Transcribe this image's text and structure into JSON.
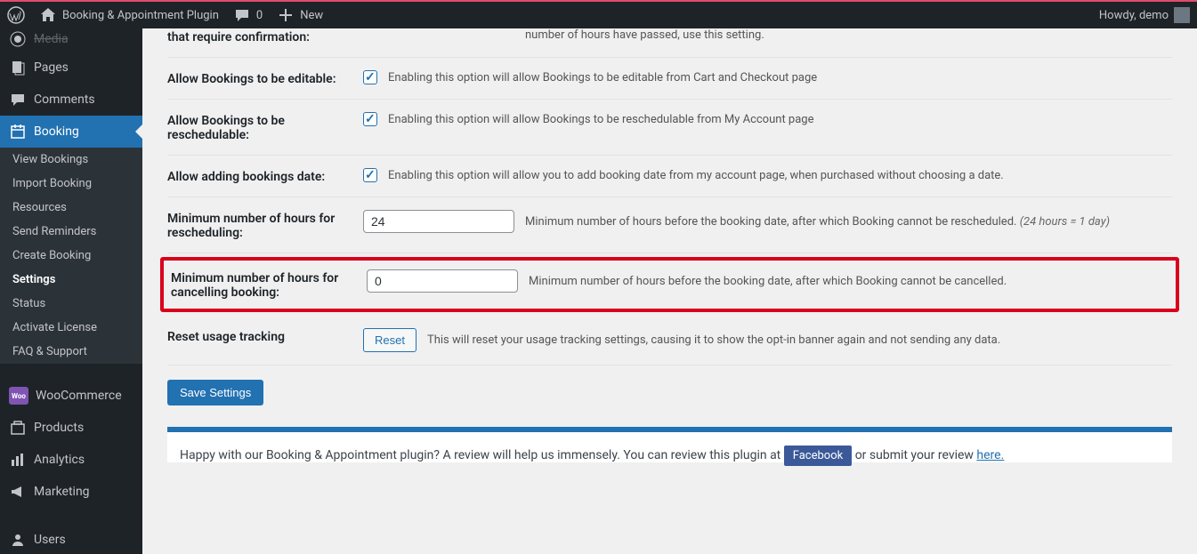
{
  "adminbar": {
    "site_title": "Booking & Appointment Plugin",
    "comments_count": "0",
    "new_label": "New",
    "howdy": "Howdy, demo"
  },
  "sidebar": {
    "media": "Media",
    "pages": "Pages",
    "comments": "Comments",
    "booking": "Booking",
    "booking_submenu": [
      "View Bookings",
      "Import Booking",
      "Resources",
      "Send Reminders",
      "Create Booking",
      "Settings",
      "Status",
      "Activate License",
      "FAQ & Support"
    ],
    "woocommerce": "WooCommerce",
    "products": "Products",
    "analytics": "Analytics",
    "marketing": "Marketing",
    "users": "Users"
  },
  "settings": {
    "confirmation_row_label": "that require confirmation:",
    "confirmation_row_desc": "number of hours have passed, use this setting.",
    "editable_label": "Allow Bookings to be editable:",
    "editable_desc": "Enabling this option will allow Bookings to be editable from Cart and Checkout page",
    "reschedulable_label": "Allow Bookings to be reschedulable:",
    "reschedulable_desc": "Enabling this option will allow Bookings to be reschedulable from My Account page",
    "add_date_label": "Allow adding bookings date:",
    "add_date_desc": "Enabling this option will allow you to add booking date from my account page, when purchased without choosing a date.",
    "min_resched_label": "Minimum number of hours for rescheduling:",
    "min_resched_value": "24",
    "min_resched_desc": "Minimum number of hours before the booking date, after which Booking cannot be rescheduled.",
    "min_resched_hint": "(24 hours = 1 day)",
    "min_cancel_label": "Minimum number of hours for cancelling booking:",
    "min_cancel_value": "0",
    "min_cancel_desc": "Minimum number of hours before the booking date, after which Booking cannot be cancelled.",
    "reset_label": "Reset usage tracking",
    "reset_button": "Reset",
    "reset_desc": "This will reset your usage tracking settings, causing it to show the opt-in banner again and not sending any data.",
    "save_button": "Save Settings"
  },
  "footer": {
    "text_before": "Happy with our Booking & Appointment plugin? A review will help us immensely. You can review this plugin at ",
    "fb": "Facebook",
    "text_mid": " or submit your review ",
    "here": "here."
  }
}
